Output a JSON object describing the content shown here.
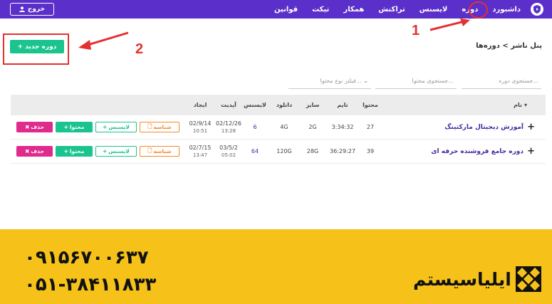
{
  "nav": {
    "items": [
      {
        "label": "داشبورد",
        "active": false
      },
      {
        "label": "دوره",
        "active": true
      },
      {
        "label": "لایسنس",
        "active": false
      },
      {
        "label": "تراکنش",
        "active": false
      },
      {
        "label": "همکار",
        "active": false
      },
      {
        "label": "تیکت",
        "active": false
      },
      {
        "label": "قوانین",
        "active": false
      }
    ],
    "logout_label": "خروج",
    "logo_icon": "shield-play-icon"
  },
  "annotations": {
    "step1": "1",
    "step2": "2",
    "color": "#e53030"
  },
  "header": {
    "breadcrumb": "پنل ناشر > دوره‌ها",
    "new_course_label": "دوره جدید"
  },
  "filters": {
    "search_course_placeholder": "جستجوی دوره...",
    "search_content_placeholder": "جستجوی محتوا...",
    "content_type_placeholder": "فیلتر نوع محتوا..."
  },
  "table": {
    "columns": {
      "name": "نام",
      "content": "محتوا",
      "time": "تایم",
      "size": "سایز",
      "download": "دانلود",
      "license": "لایسنس",
      "updated": "آپدیت",
      "created": "ایجاد"
    },
    "rows": [
      {
        "name": "آموزش دیجیتال مارکتینگ",
        "content": "27",
        "time": "3:34:32",
        "size": "2G",
        "download": "4G",
        "license": "6",
        "updated_date": "02/12/26",
        "updated_time": "13:28",
        "created_date": "02/9/14",
        "created_time": "10:51"
      },
      {
        "name": "دوره جامع فروشنده حرفه ای",
        "content": "39",
        "time": "36:29:27",
        "size": "28G",
        "download": "120G",
        "license": "64",
        "updated_date": "03/5/2",
        "updated_time": "05:02",
        "created_date": "02/7/15",
        "created_time": "13:47"
      }
    ],
    "actions": {
      "id_label": "شناسه",
      "license_label": "لایسنس",
      "content_label": "محتوا",
      "delete_label": "حذف"
    }
  },
  "banner": {
    "phone1": "۰۹۱۵۶۷۰۰۶۳۷",
    "phone2": "۰۵۱-۳۸۴۱۱۸۳۳",
    "brand": "ایلیاسیستم",
    "color": "#f6c21a"
  },
  "colors": {
    "primary": "#5b2fc9",
    "green": "#1bc48f",
    "pink": "#e02a8c",
    "orange": "#f5882a"
  }
}
